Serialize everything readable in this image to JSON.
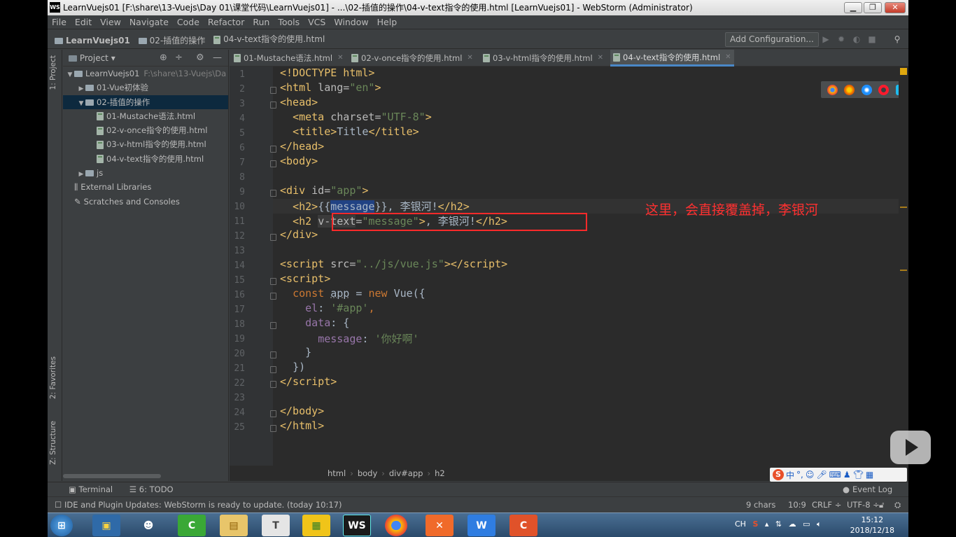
{
  "window": {
    "title": "LearnVuejs01 [F:\\share\\13-Vuejs\\Day 01\\课堂代码\\LearnVuejs01] - ...\\02-插值的操作\\04-v-text指令的使用.html [LearnVuejs01] - WebStorm (Administrator)",
    "app_icon": "WS",
    "controls": [
      "minimize-icon",
      "maximize-icon",
      "close-icon"
    ]
  },
  "menu": [
    "File",
    "Edit",
    "View",
    "Navigate",
    "Code",
    "Refactor",
    "Run",
    "Tools",
    "VCS",
    "Window",
    "Help"
  ],
  "navbar": {
    "crumbs": [
      "LearnVuejs01",
      "02-插值的操作",
      "04-v-text指令的使用.html"
    ],
    "add_configuration": "Add Configuration..."
  },
  "left_strip": {
    "project": "1: Project",
    "favorites": "2: Favorites",
    "structure": "Z: Structure"
  },
  "project_panel": {
    "header": "Project",
    "tree": [
      {
        "label": "LearnVuejs01",
        "hint": "F:\\share\\13-Vuejs\\Da",
        "indent": 0,
        "arrow": "▼",
        "icon": "folder"
      },
      {
        "label": "01-Vue初体验",
        "indent": 1,
        "arrow": "▶",
        "icon": "folder"
      },
      {
        "label": "02-插值的操作",
        "indent": 1,
        "arrow": "▼",
        "icon": "folder",
        "selected": true
      },
      {
        "label": "01-Mustache语法.html",
        "indent": 2,
        "icon": "file"
      },
      {
        "label": "02-v-once指令的使用.html",
        "indent": 2,
        "icon": "file"
      },
      {
        "label": "03-v-html指令的使用.html",
        "indent": 2,
        "icon": "file"
      },
      {
        "label": "04-v-text指令的使用.html",
        "indent": 2,
        "icon": "file"
      },
      {
        "label": "js",
        "indent": 1,
        "arrow": "▶",
        "icon": "folder"
      },
      {
        "label": "External Libraries",
        "indent": 0,
        "icon": "library"
      },
      {
        "label": "Scratches and Consoles",
        "indent": 0,
        "icon": "scratch"
      }
    ]
  },
  "tabs": [
    {
      "label": "01-Mustache语法.html"
    },
    {
      "label": "02-v-once指令的使用.html"
    },
    {
      "label": "03-v-html指令的使用.html"
    },
    {
      "label": "04-v-text指令的使用.html",
      "active": true
    }
  ],
  "line_numbers": [
    "1",
    "2",
    "3",
    "4",
    "5",
    "6",
    "7",
    "8",
    "9",
    "10",
    "11",
    "12",
    "13",
    "14",
    "15",
    "16",
    "17",
    "18",
    "19",
    "20",
    "21",
    "22",
    "23",
    "24",
    "25"
  ],
  "annotation": "这里，会直接覆盖掉，李银河",
  "browsers": [
    "chrome-icon",
    "firefox-icon",
    "safari-icon",
    "opera-icon",
    "ie-icon",
    "edge-icon"
  ],
  "breadcrumb": [
    "html",
    "body",
    "div#app",
    "h2"
  ],
  "bottom_tabs": {
    "terminal": "Terminal",
    "todo": "6: TODO",
    "event_log": "Event Log"
  },
  "status": {
    "message": "IDE and Plugin Updates: WebStorm is ready to update. (today 10:17)",
    "chars": "9 chars",
    "position": "10:9",
    "line_sep": "CRLF ÷",
    "encoding": "UTF-8 ÷"
  },
  "ime": {
    "label": "中"
  },
  "taskbar": {
    "time": "15:12",
    "date": "2018/12/18",
    "lang": "CH"
  },
  "colors": {
    "accent": "#4a88c7",
    "annotation": "#ff3030",
    "tag": "#e8bf6a",
    "string": "#6a8759",
    "keyword": "#cc7832"
  }
}
